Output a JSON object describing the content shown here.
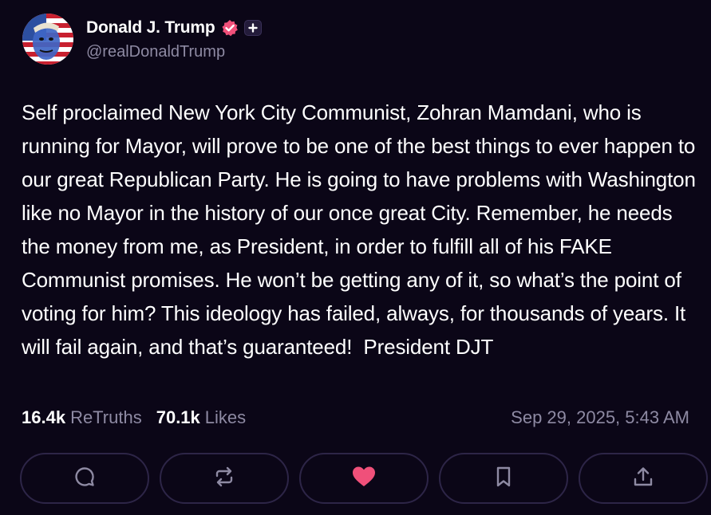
{
  "author": {
    "display_name": "Donald J. Trump",
    "handle": "@realDonaldTrump",
    "verified_icon": "verified-badge-icon",
    "plus_icon": "plus-badge-icon"
  },
  "post": {
    "text": "Self proclaimed New York City Communist, Zohran Mamdani, who is running for Mayor, will prove to be one of the best things to ever happen to our great Republican Party. He is going to have problems with Washington like no Mayor in the history of our once great City. Remember, he needs the money from me, as President, in order to fulfill all of his FAKE Communist promises. He won’t be getting any of it, so what’s the point of voting for him? This ideology has failed, always, for thousands of years. It will fail again, and that’s guaranteed!  President DJT"
  },
  "stats": {
    "retruths_count": "16.4k",
    "retruths_label": "ReTruths",
    "likes_count": "70.1k",
    "likes_label": "Likes"
  },
  "timestamp": "Sep 29, 2025, 5:43 AM",
  "actions": [
    "reply-icon",
    "retruth-icon",
    "like-icon",
    "bookmark-icon",
    "share-icon"
  ],
  "colors": {
    "background": "#0b0617",
    "muted_text": "#8e8aa3",
    "like_accent": "#f0507a",
    "verified": "#f0507a"
  }
}
